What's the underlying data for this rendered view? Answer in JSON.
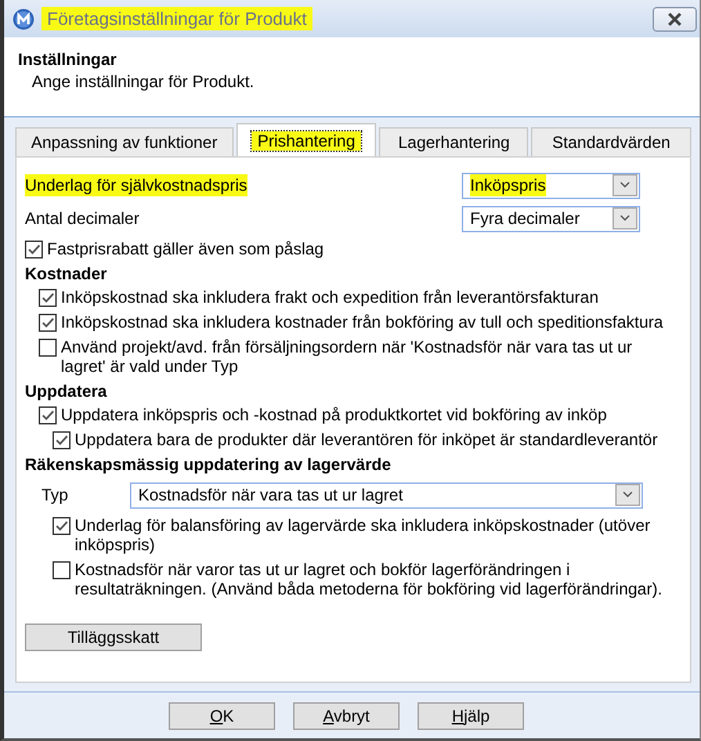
{
  "window": {
    "title": "Företagsinställningar för Produkt",
    "title_highlighted": true
  },
  "header": {
    "title": "Inställningar",
    "subtitle": "Ange inställningar för Produkt."
  },
  "tabs": [
    {
      "label": "Anpassning av funktioner",
      "selected": false,
      "highlighted": false
    },
    {
      "label": "Prishantering",
      "selected": true,
      "highlighted": true
    },
    {
      "label": "Lagerhantering",
      "selected": false,
      "highlighted": false
    },
    {
      "label": "Standardvärden",
      "selected": false,
      "highlighted": false
    }
  ],
  "items": [
    {
      "kind": "select",
      "label": "Underlag för självkostnadspris",
      "value": "Inköpspris",
      "highlighted": true
    },
    {
      "kind": "select",
      "label": "Antal decimaler",
      "value": "Fyra decimaler",
      "highlighted": false
    },
    {
      "kind": "checkbox",
      "label": "Fastprisrabatt gäller även som påslag",
      "checked": true
    },
    {
      "kind": "section",
      "title": "Kostnader",
      "children": [
        {
          "kind": "checkbox",
          "label": "Inköpskostnad ska inkludera frakt och expedition från leverantörsfakturan",
          "checked": true
        },
        {
          "kind": "checkbox",
          "label": "Inköpskostnad ska inkludera kostnader från bokföring av tull och speditionsfaktura",
          "checked": true
        },
        {
          "kind": "checkbox",
          "label": "Använd projekt/avd. från försäljningsordern när 'Kostnadsför när vara tas ut ur lagret' är vald under Typ",
          "checked": false
        }
      ]
    },
    {
      "kind": "section",
      "title": "Uppdatera",
      "children": [
        {
          "kind": "checkbox",
          "label": "Uppdatera inköpspris och -kostnad på produktkortet vid bokföring av inköp",
          "checked": true,
          "children": [
            {
              "kind": "checkbox",
              "label": "Uppdatera bara de produkter där leverantören för inköpet är standardleverantör",
              "checked": true
            }
          ]
        }
      ]
    },
    {
      "kind": "section",
      "title": "Räkenskapsmässig uppdatering av lagervärde",
      "children": [
        {
          "kind": "select",
          "label": "Typ",
          "value": "Kostnadsför när vara tas ut ur lagret",
          "highlighted": false,
          "children": [
            {
              "kind": "checkbox",
              "label": "Underlag för balansföring av lagervärde ska inkludera inköpskostnader (utöver inköpspris)",
              "checked": true
            },
            {
              "kind": "checkbox",
              "label": "Kostnadsför när varor tas ut ur lagret och bokför lagerförändringen i resultaträkningen. (Använd båda metoderna för bokföring vid lagerförändringar).",
              "checked": false
            }
          ]
        }
      ]
    },
    {
      "kind": "button",
      "label": "Tilläggsskatt"
    }
  ],
  "buttons": [
    {
      "label": "OK"
    },
    {
      "label": "Avbryt"
    },
    {
      "label": "Hjälp"
    }
  ]
}
